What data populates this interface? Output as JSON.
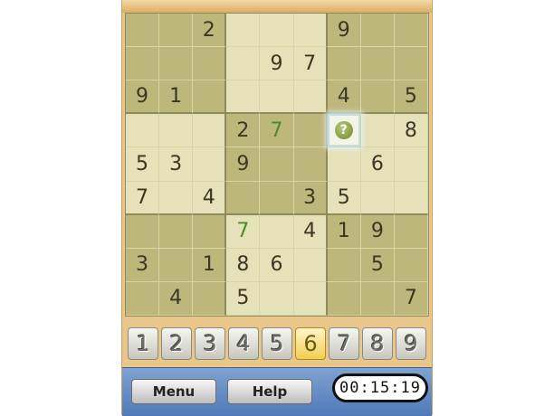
{
  "board": [
    [
      "",
      "",
      "2",
      "",
      "",
      "",
      "9",
      "",
      ""
    ],
    [
      "",
      "",
      "",
      "",
      "9",
      "7",
      "",
      "",
      ""
    ],
    [
      "9",
      "1",
      "",
      "",
      "",
      "",
      "4",
      "",
      "5"
    ],
    [
      "",
      "",
      "",
      "2",
      "7",
      "",
      "?",
      "",
      "8"
    ],
    [
      "5",
      "3",
      "",
      "9",
      "",
      "",
      "",
      "6",
      ""
    ],
    [
      "7",
      "",
      "4",
      "",
      "",
      "3",
      "5",
      "",
      ""
    ],
    [
      "",
      "",
      "",
      "7",
      "",
      "4",
      "1",
      "9",
      ""
    ],
    [
      "3",
      "",
      "1",
      "8",
      "6",
      "",
      "",
      "5",
      ""
    ],
    [
      "",
      "4",
      "",
      "5",
      "",
      "",
      "",
      "",
      "7"
    ]
  ],
  "player_entries": [
    [
      3,
      4
    ],
    [
      6,
      3
    ]
  ],
  "selected_cell": [
    3,
    6
  ],
  "numpad": [
    "1",
    "2",
    "3",
    "4",
    "5",
    "6",
    "7",
    "8",
    "9"
  ],
  "numpad_active": "6",
  "buttons": {
    "menu": "Menu",
    "help": "Help"
  },
  "timer": "00:15:19"
}
